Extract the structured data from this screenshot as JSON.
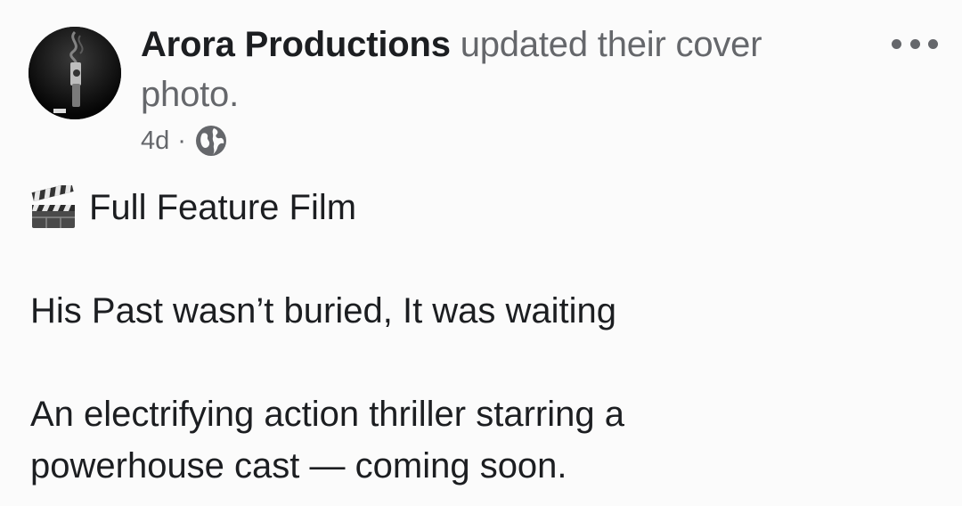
{
  "post": {
    "author": "Arora Productions",
    "action": "updated their cover photo.",
    "time": "4d",
    "separator": "·",
    "privacy_icon": "globe-icon",
    "more_icon": "more-options-icon",
    "avatar_icon": "profile-avatar",
    "body": {
      "title_icon": "clapper-board-icon",
      "title": "Full Feature Film",
      "tagline": "His Past wasn’t buried, It was waiting",
      "description_line1": "An electrifying action thriller starring a",
      "description_line2": "powerhouse cast — coming soon."
    }
  },
  "colors": {
    "primary_text": "#1c1e21",
    "secondary_text": "#65676b",
    "background": "#fbfbfb"
  }
}
